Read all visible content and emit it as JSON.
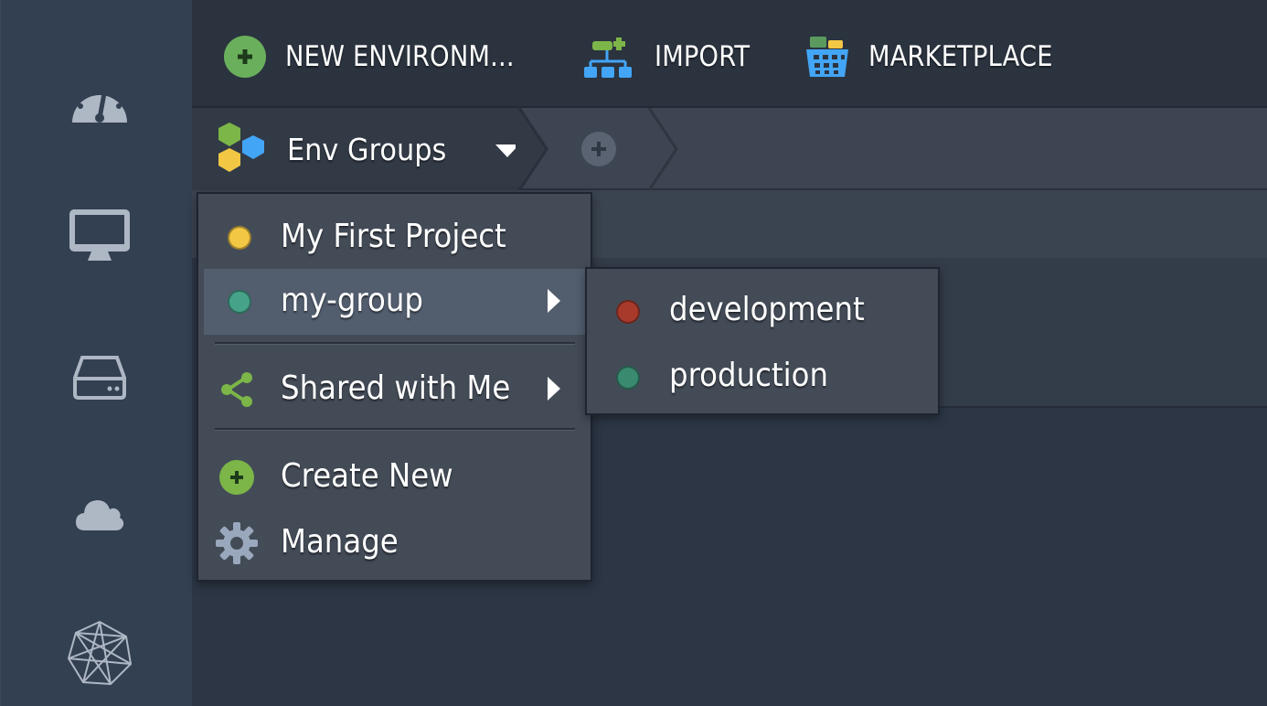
{
  "toolbar": {
    "new_environment_label": "NEW ENVIRONM...",
    "import_label": "IMPORT",
    "marketplace_label": "MARKETPLACE"
  },
  "sidebar": {
    "items": [
      {
        "icon": "dashboard-gauge-icon"
      },
      {
        "icon": "monitor-icon"
      },
      {
        "icon": "storage-drive-icon"
      },
      {
        "icon": "cloud-icon"
      },
      {
        "icon": "network-mesh-icon"
      }
    ]
  },
  "tabs": {
    "active_label": "Env Groups"
  },
  "menu": {
    "items": [
      {
        "label": "My First Project",
        "dot_color": "#f2c744"
      },
      {
        "label": "my-group",
        "dot_color": "#46a38a"
      },
      {
        "label": "Shared with Me"
      },
      {
        "label": "Create New"
      },
      {
        "label": "Manage"
      }
    ]
  },
  "submenu": {
    "items": [
      {
        "label": "development",
        "dot_color": "#a83a2c"
      },
      {
        "label": "production",
        "dot_color": "#3a8a70"
      }
    ]
  },
  "colors": {
    "accent_green": "#7cb548",
    "blue_icon": "#42a5f5",
    "yellow": "#f2c744"
  }
}
